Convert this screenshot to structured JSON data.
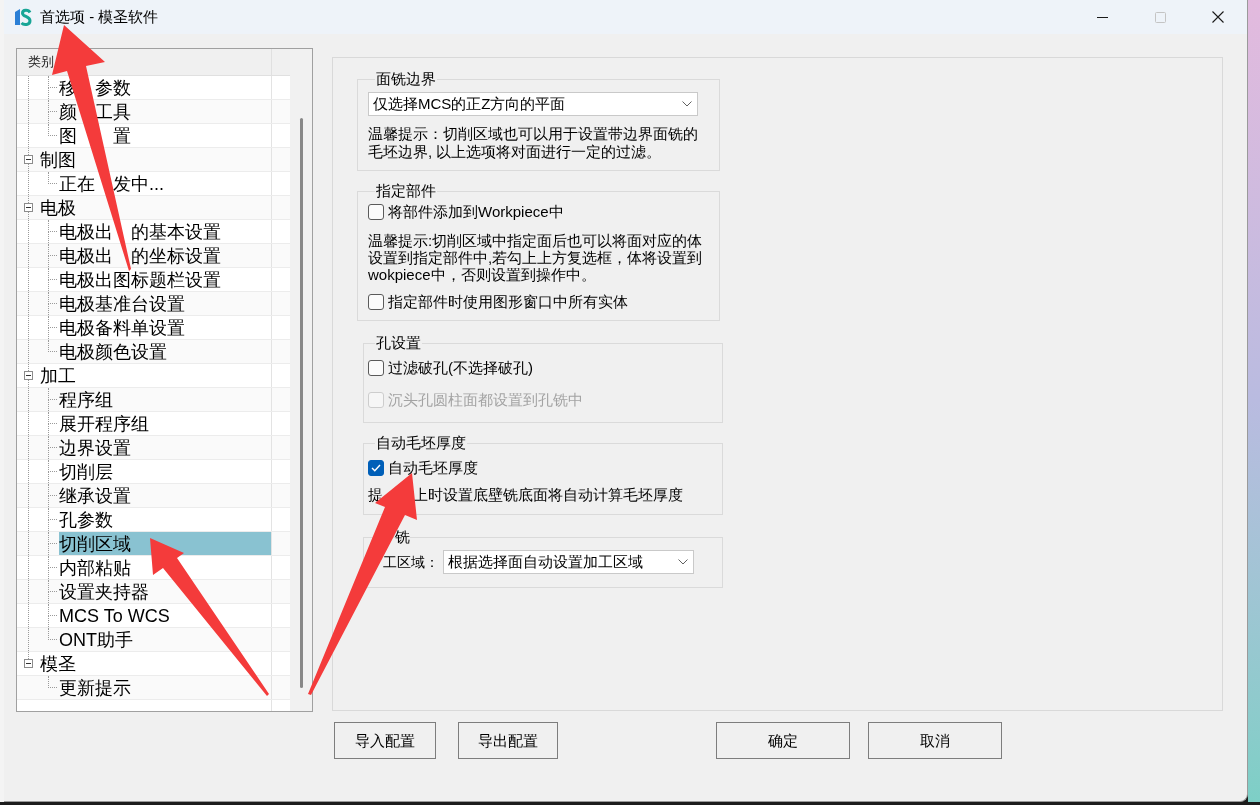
{
  "window": {
    "title": "首选项 - 模圣软件",
    "controls": [
      {
        "kind": "minimize",
        "disabled": false
      },
      {
        "kind": "maximize",
        "disabled": true
      },
      {
        "kind": "close",
        "disabled": false
      }
    ]
  },
  "tree": {
    "header": "类别",
    "items": [
      {
        "children": [
          {
            "label": "移　参数",
            "selected": false
          },
          {
            "label": "颜　工具",
            "selected": false
          },
          {
            "label": "图　　置",
            "selected": false
          }
        ]
      },
      {
        "label": "制图",
        "expanded": true,
        "selected": false,
        "children": [
          {
            "label": "正在　发中...",
            "selected": false
          }
        ]
      },
      {
        "label": "电极",
        "expanded": true,
        "selected": false,
        "children": [
          {
            "label": "电极出　的基本设置",
            "selected": false
          },
          {
            "label": "电极出　的坐标设置",
            "selected": false
          },
          {
            "label": "电极出图标题栏设置",
            "selected": false
          },
          {
            "label": "电极基准台设置",
            "selected": false
          },
          {
            "label": "电极备料单设置",
            "selected": false
          },
          {
            "label": "电极颜色设置",
            "selected": false
          }
        ]
      },
      {
        "label": "加工",
        "expanded": true,
        "selected": false,
        "children": [
          {
            "label": "程序组",
            "selected": false
          },
          {
            "label": "展开程序组",
            "selected": false
          },
          {
            "label": "边界设置",
            "selected": false
          },
          {
            "label": "切削层",
            "selected": false
          },
          {
            "label": "继承设置",
            "selected": false
          },
          {
            "label": "孔参数",
            "selected": false
          },
          {
            "label": "切削区域",
            "selected": true
          },
          {
            "label": "内部粘贴",
            "selected": false
          },
          {
            "label": "设置夹持器",
            "selected": false
          },
          {
            "label": "MCS To WCS",
            "selected": false
          },
          {
            "label": "ONT助手",
            "selected": false
          }
        ]
      },
      {
        "label": "模圣",
        "expanded": true,
        "selected": false,
        "children": [
          {
            "label": "更新提示",
            "selected": false
          }
        ]
      }
    ]
  },
  "groups": [
    {
      "title": "面铣边界",
      "controls": [
        {
          "kind": "select",
          "value": "仅选择MCS的正Z方向的平面"
        },
        {
          "kind": "hint",
          "text": "温馨提示：切削区域也可以用于设置带边界面铣的毛坯边界, 以上选项将对面进行一定的过滤。"
        }
      ]
    },
    {
      "title": "指定部件",
      "controls": [
        {
          "kind": "checkbox",
          "label": "将部件添加到Workpiece中",
          "checked": false,
          "disabled": false
        },
        {
          "kind": "hint",
          "text": "温馨提示:切削区域中指定面后也可以将面对应的体设置到指定部件中,若勾上上方复选框，体将设置到wokpiece中，否则设置到操作中。"
        },
        {
          "kind": "checkbox",
          "label": "指定部件时使用图形窗口中所有实体",
          "checked": false,
          "disabled": false
        }
      ]
    },
    {
      "title": "孔设置",
      "controls": [
        {
          "kind": "checkbox",
          "label": "过滤破孔(不选择破孔)",
          "checked": false,
          "disabled": false
        },
        {
          "kind": "checkbox",
          "label": "沉头孔圆柱面都设置到孔铣中",
          "checked": false,
          "disabled": true
        }
      ]
    },
    {
      "title": "自动毛坯厚度",
      "controls": [
        {
          "kind": "checkbox",
          "label": "自动毛坯厚度",
          "checked": true,
          "disabled": false
        },
        {
          "kind": "hint",
          "text": "提　　上时设置底壁铣底面将自动计算毛坯厚度"
        }
      ]
    },
    {
      "title": "铣",
      "controls": [
        {
          "kind": "labeled_select",
          "label": "工区域：",
          "value": "根据选择面自动设置加工区域"
        }
      ]
    }
  ],
  "buttons": [
    "导入配置",
    "导出配置",
    "确定",
    "取消"
  ],
  "annotations": [
    {
      "kind": "arrow"
    },
    {
      "kind": "arrow"
    },
    {
      "kind": "arrow"
    }
  ]
}
